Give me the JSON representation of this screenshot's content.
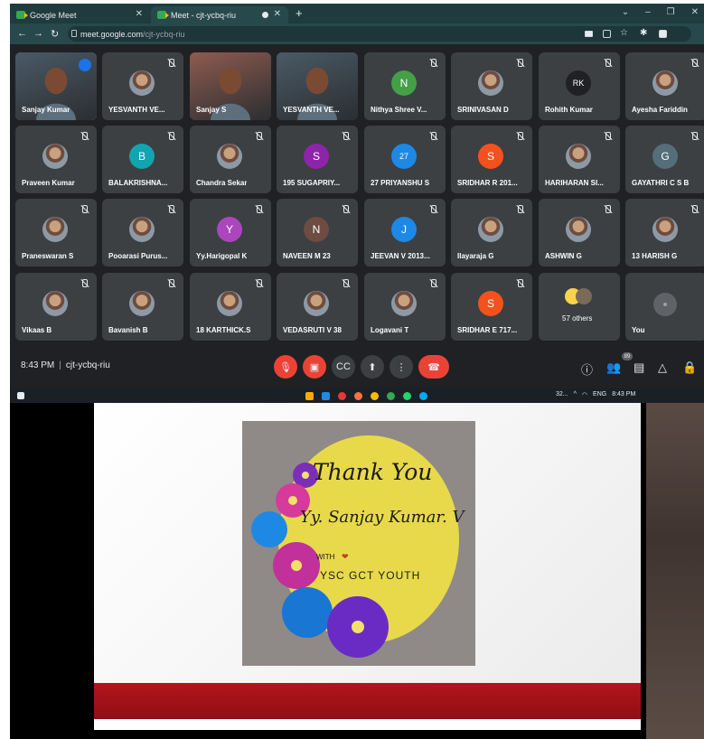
{
  "browser": {
    "tabs": [
      {
        "title": "Google Meet"
      },
      {
        "title": "Meet - cjt-ycbq-riu"
      }
    ],
    "url_host": "meet.google.com",
    "url_path": "/cjt-ycbq-riu"
  },
  "participants": [
    {
      "name": "Sanjay Kumar",
      "kind": "video",
      "speaking": true
    },
    {
      "name": "YESVANTH VE...",
      "kind": "photo"
    },
    {
      "name": "Sanjay S",
      "kind": "video"
    },
    {
      "name": "YESVANTH VE...",
      "kind": "video"
    },
    {
      "name": "Nithya Shree V...",
      "kind": "initial",
      "initial": "N",
      "color": "#43a047"
    },
    {
      "name": "SRINIVASAN D",
      "kind": "photo"
    },
    {
      "name": "Rohith Kumar",
      "kind": "initial",
      "initial": "RK",
      "color": "#202124"
    },
    {
      "name": "Ayesha Fariddin",
      "kind": "photo"
    },
    {
      "name": "Praveen Kumar",
      "kind": "photo"
    },
    {
      "name": "BALAKRISHNA...",
      "kind": "initial",
      "initial": "B",
      "color": "#12a4af"
    },
    {
      "name": "Chandra Sekar",
      "kind": "photo"
    },
    {
      "name": "195 SUGAPRIY...",
      "kind": "initial",
      "initial": "S",
      "color": "#8e24aa"
    },
    {
      "name": "27 PRIYANSHU S",
      "kind": "initial",
      "initial": "27",
      "color": "#1e88e5"
    },
    {
      "name": "SRIDHAR R 201...",
      "kind": "initial",
      "initial": "S",
      "color": "#f4511e"
    },
    {
      "name": "HARIHARAN SI...",
      "kind": "photo"
    },
    {
      "name": "GAYATHRI C S B",
      "kind": "initial",
      "initial": "G",
      "color": "#546e7a"
    },
    {
      "name": "Praneswaran S",
      "kind": "photo"
    },
    {
      "name": "Pooarasi Purus...",
      "kind": "photo"
    },
    {
      "name": "Yy.Harigopal K",
      "kind": "initial",
      "initial": "Y",
      "color": "#ab47bc"
    },
    {
      "name": "NAVEEN M 23",
      "kind": "initial",
      "initial": "N",
      "color": "#6d4c41"
    },
    {
      "name": "JEEVAN V 2013...",
      "kind": "initial",
      "initial": "J",
      "color": "#1e88e5"
    },
    {
      "name": "Ilayaraja G",
      "kind": "photo"
    },
    {
      "name": "ASHWIN G",
      "kind": "photo"
    },
    {
      "name": "13 HARISH G",
      "kind": "photo"
    },
    {
      "name": "Vikaas B",
      "kind": "photo"
    },
    {
      "name": "Bavanish B",
      "kind": "photo"
    },
    {
      "name": "18 KARTHICK.S",
      "kind": "photo"
    },
    {
      "name": "VEDASRUTI V 38",
      "kind": "photo"
    },
    {
      "name": "Logavani T",
      "kind": "photo"
    },
    {
      "name": "SRIDHAR E 717...",
      "kind": "initial",
      "initial": "S",
      "color": "#f4511e"
    },
    {
      "name": "57 others",
      "kind": "others"
    },
    {
      "name": "You",
      "kind": "you"
    }
  ],
  "meeting": {
    "time": "8:43 PM",
    "code": "cjt-ycbq-riu",
    "people_badge": "89"
  },
  "taskbar": {
    "temp": "32...",
    "lang": "ENG",
    "time": "8:43 PM"
  },
  "slide": {
    "thanks": "Thank You",
    "from_name": "Yy. Sanjay Kumar. V",
    "with": "WITH",
    "org": "YSC GCT YOUTH"
  },
  "colors": {
    "accent_red": "#ea4335",
    "tile_bg": "#3c4043",
    "slide_band": "#b3141c",
    "disc_yellow": "#e8d94b"
  }
}
